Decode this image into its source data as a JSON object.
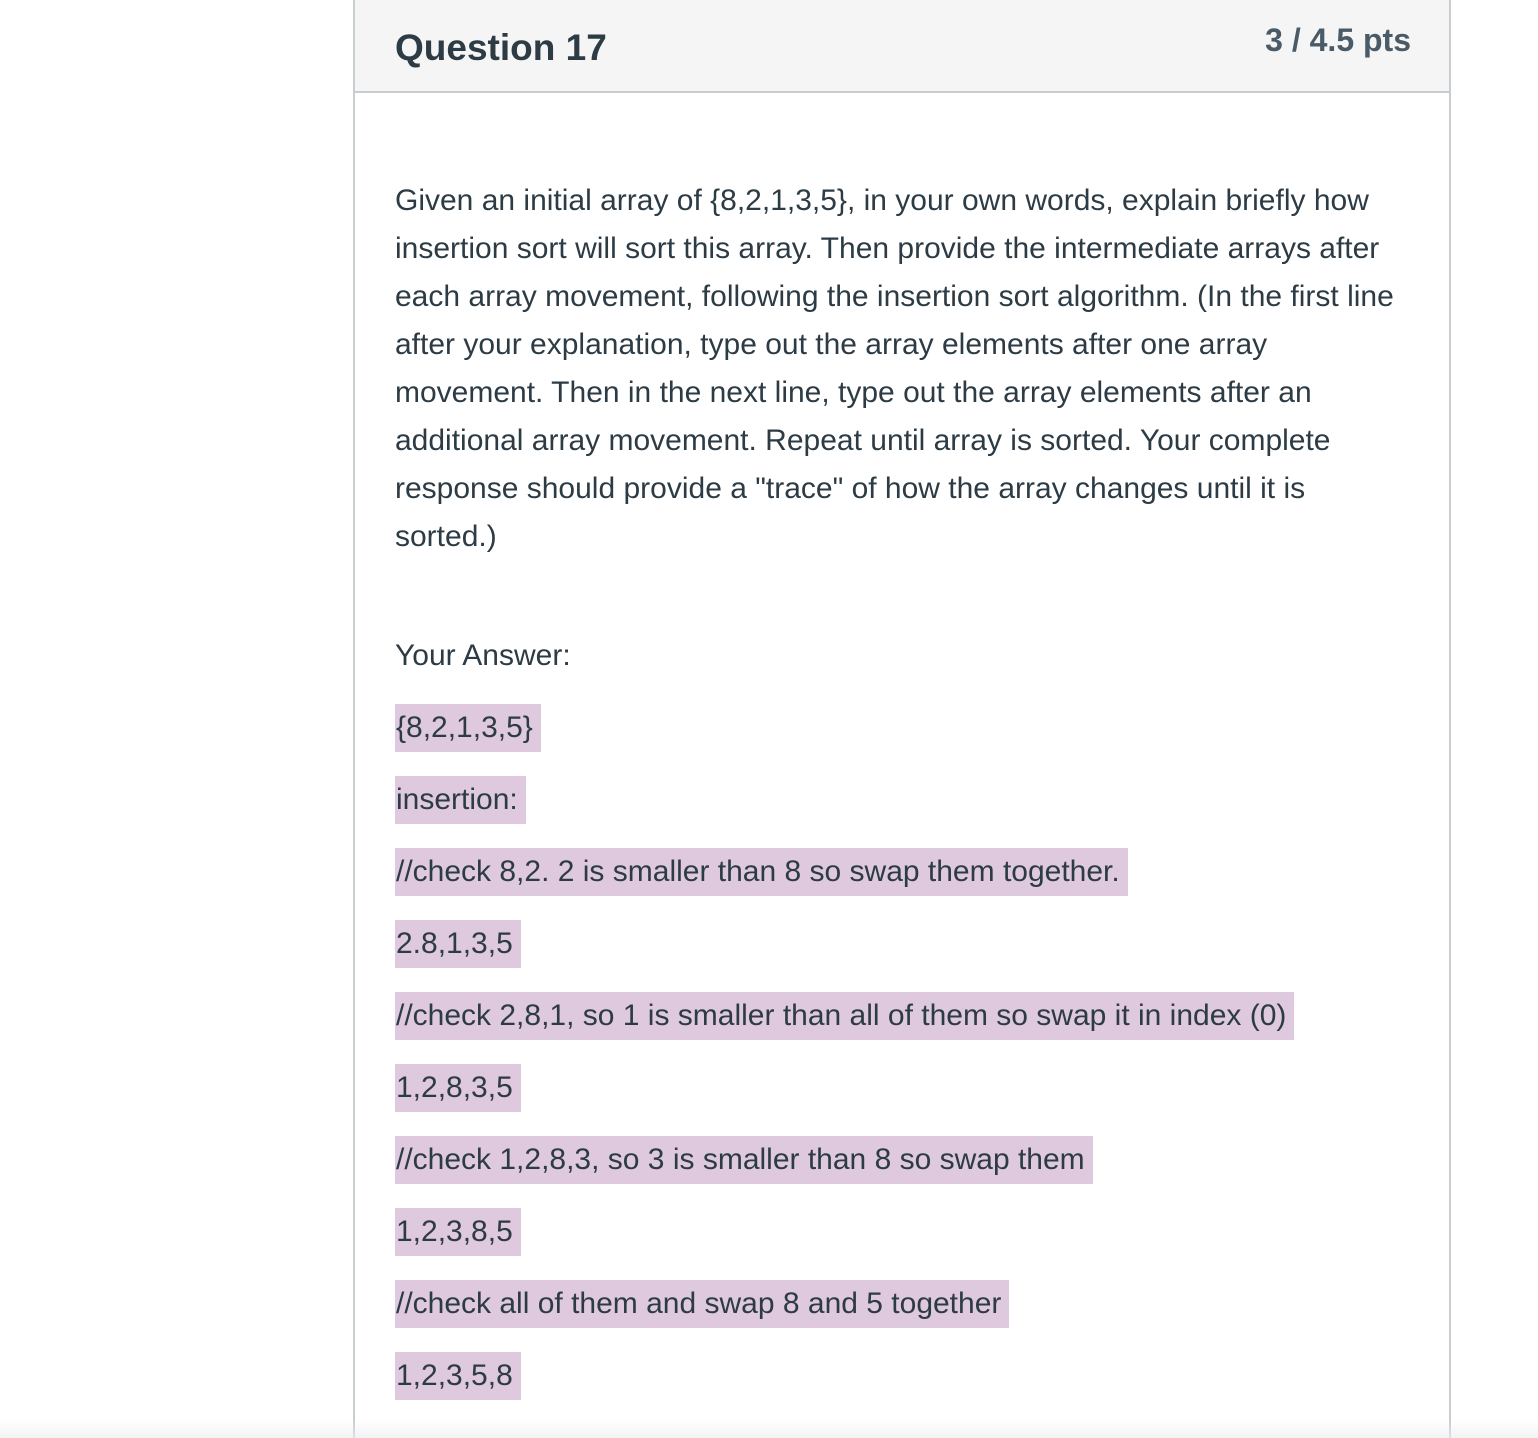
{
  "question": {
    "title": "Question 17",
    "points": "3 / 4.5 pts",
    "prompt": "Given an initial array of {8,2,1,3,5}, in your own words, explain briefly how insertion sort will sort this array.  Then provide the intermediate arrays after each array movement, following the insertion sort algorithm.  (In the first line after your explanation, type out the array elements after one array movement.  Then in the next line, type out the array elements after an additional array movement.  Repeat until array is sorted.  Your complete response should provide a \"trace\" of how the array changes until it is sorted.)"
  },
  "answer": {
    "label": "Your Answer:",
    "lines": [
      "{8,2,1,3,5}",
      "insertion:",
      "//check 8,2. 2 is smaller than 8 so swap them together.",
      "2.8,1,3,5",
      "//check 2,8,1, so 1 is smaller than all of them so swap it in index (0)",
      "1,2,8,3,5",
      "//check 1,2,8,3, so 3 is smaller than 8 so swap them",
      "1,2,3,8,5",
      "//check all of them and swap 8 and 5 together",
      "1,2,3,5,8"
    ],
    "highlight_color": "#dfc9df"
  }
}
